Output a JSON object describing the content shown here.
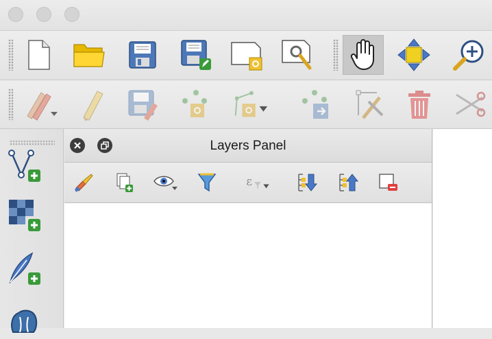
{
  "window": {
    "controls": [
      "close",
      "minimize",
      "zoom"
    ]
  },
  "toolbars": {
    "file": [
      "new-project-icon",
      "open-project-icon",
      "save-project-icon",
      "save-as-icon",
      "new-print-layout-icon",
      "layout-manager-icon",
      "pan-map-icon",
      "pan-to-selection-icon",
      "zoom-in-icon"
    ],
    "digitizing": [
      "current-edits-icon",
      "toggle-editing-icon",
      "save-layer-edits-icon",
      "add-point-feature-icon",
      "vertex-tool-icon",
      "move-feature-icon",
      "node-tool-icon",
      "delete-selected-icon",
      "cut-features-icon"
    ],
    "active_tool": "pan-map-icon"
  },
  "layer_toolbar": [
    "new-vector-layer-icon",
    "new-raster-layer-icon",
    "add-delimited-text-layer-icon",
    "add-postgis-layer-icon"
  ],
  "layers_panel": {
    "title": "Layers Panel",
    "tools": [
      "open-layer-styling-icon",
      "add-group-icon",
      "manage-map-themes-icon",
      "filter-legend-icon",
      "filter-by-expression-icon",
      "expand-all-icon",
      "collapse-all-icon",
      "remove-layer-icon"
    ]
  }
}
